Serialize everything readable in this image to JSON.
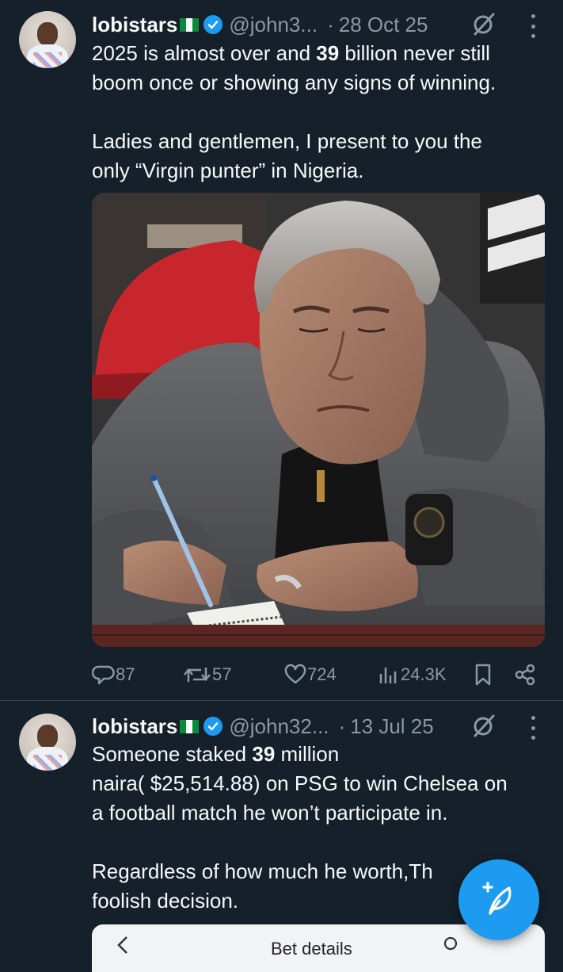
{
  "colors": {
    "background": "#15202b",
    "accent": "#1d9bf0",
    "muted": "#8b98a5",
    "text": "#f7f9f9"
  },
  "tweets": [
    {
      "author": {
        "name": "lobistars",
        "handle": "@john3...",
        "verified": true,
        "flag": "nigeria-flag"
      },
      "date": "28 Oct 25",
      "text_lines": [
        {
          "before": "2025 is almost over and ",
          "bold": "39",
          "after": " billion never still"
        },
        "boom once or showing any signs of winning.",
        "Ladies and gentlemen, I present to you the",
        "only “Virgin punter” in Nigeria."
      ],
      "stats": {
        "replies": "87",
        "reposts": "57",
        "likes": "724",
        "views": "24.3K"
      }
    },
    {
      "author": {
        "name": "lobistars",
        "handle": "@john32...",
        "verified": true,
        "flag": "nigeria-flag"
      },
      "date": "13 Jul 25",
      "text_lines": [
        {
          "before": "Someone staked ",
          "bold": "39",
          "after": " million"
        },
        "naira( $25,514.88) on PSG to win Chelsea on",
        "a football match he won’t participate in.",
        "Regardless of how much he worth,Th",
        "foolish decision."
      ]
    }
  ],
  "embedded_card": {
    "title": "Bet details"
  },
  "fab": {
    "icon": "compose-feather-icon"
  }
}
